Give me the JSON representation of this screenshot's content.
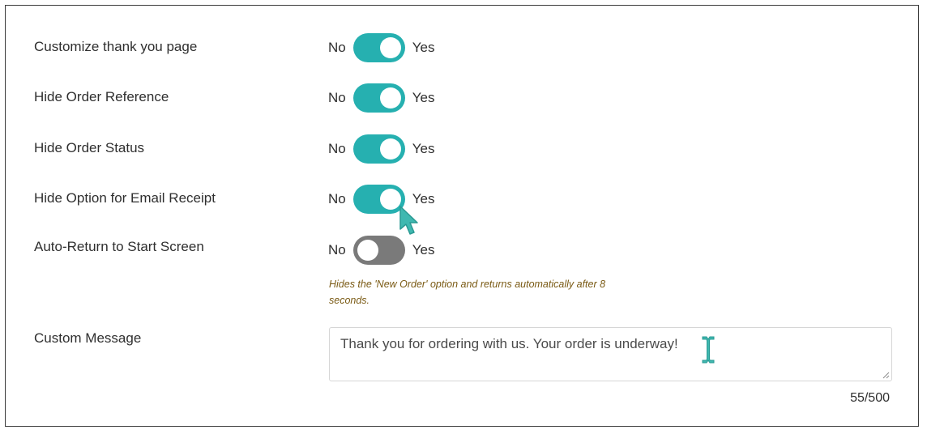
{
  "settings": {
    "toggle_no_label": "No",
    "toggle_yes_label": "Yes",
    "rows": [
      {
        "label": "Customize thank you page",
        "enabled": true
      },
      {
        "label": "Hide Order Reference",
        "enabled": true
      },
      {
        "label": "Hide Order Status",
        "enabled": true
      },
      {
        "label": "Hide Option for Email Receipt",
        "enabled": true
      },
      {
        "label": "Auto-Return to Start Screen",
        "enabled": false,
        "hint": "Hides the 'New Order' option and returns automatically after 8 seconds."
      }
    ]
  },
  "custom_message": {
    "label": "Custom Message",
    "value": "Thank you for ordering with us. Your order is underway!",
    "counter": "55/500"
  },
  "colors": {
    "toggle_on": "#26b0b0",
    "toggle_off": "#7a7a7a",
    "hint_text": "#7a5a14",
    "cursor": "#3fb8b0"
  },
  "icons": {
    "pointer_cursor": "arrow-cursor-icon",
    "text_cursor": "ibeam-cursor-icon",
    "resize": "resize-grip-icon"
  }
}
